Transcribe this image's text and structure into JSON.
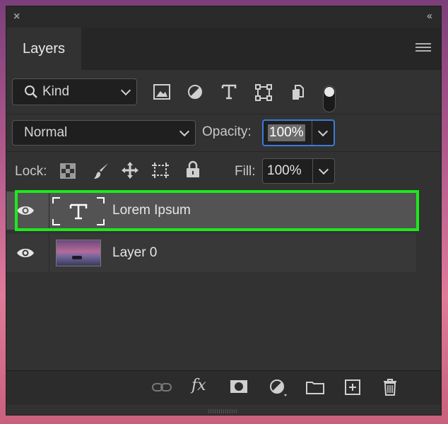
{
  "panel": {
    "tab_label": "Layers",
    "close_glyph": "×",
    "collapse_glyph": "‹‹"
  },
  "filter": {
    "kind_label": "Kind",
    "icons": [
      "image-filter-icon",
      "adjustment-filter-icon",
      "type-filter-icon",
      "shape-filter-icon",
      "smart-object-filter-icon",
      "filter-toggle"
    ]
  },
  "blend": {
    "mode": "Normal",
    "opacity_label": "Opacity:",
    "opacity_value": "100%"
  },
  "lock": {
    "label": "Lock:",
    "icons": [
      "lock-transparent-icon",
      "lock-image-icon",
      "lock-position-icon",
      "lock-artboard-icon",
      "lock-all-icon"
    ],
    "fill_label": "Fill:",
    "fill_value": "100%"
  },
  "layers": [
    {
      "name": "Lorem Ipsum",
      "type": "text",
      "visible": true,
      "selected": true
    },
    {
      "name": "Layer 0",
      "type": "image",
      "visible": true,
      "selected": false
    }
  ],
  "bottom_icons": [
    "link-layers-icon",
    "fx-icon",
    "mask-icon",
    "adjustment-layer-icon",
    "group-folder-icon",
    "new-layer-icon",
    "trash-icon"
  ],
  "fx_label": "fx",
  "colors": {
    "selection_outline": "#1ee81e",
    "panel_bg": "#323232",
    "selected_row": "#535353"
  }
}
